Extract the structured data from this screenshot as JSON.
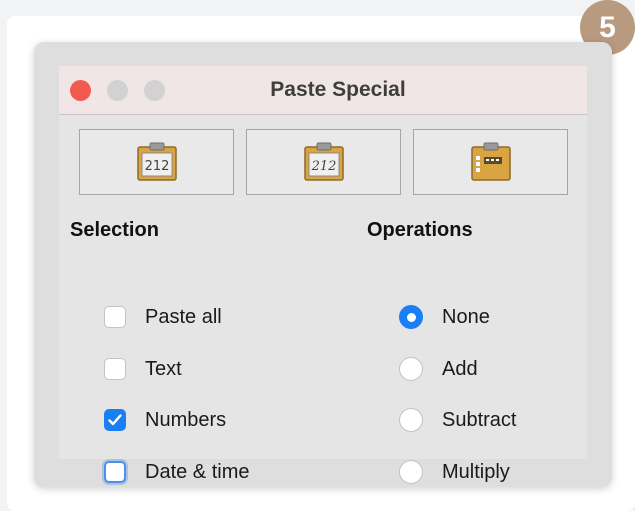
{
  "step_badge": "5",
  "window": {
    "title": "Paste Special"
  },
  "presets": [
    {
      "icon": "clipboard-numbers-icon",
      "text": "212"
    },
    {
      "icon": "clipboard-formatted-numbers-icon",
      "text": "212"
    },
    {
      "icon": "clipboard-formats-icon"
    }
  ],
  "selection": {
    "title": "Selection",
    "options": [
      {
        "label": "Paste all",
        "checked": false
      },
      {
        "label": "Text",
        "checked": false
      },
      {
        "label": "Numbers",
        "checked": true
      },
      {
        "label": "Date & time",
        "checked": false,
        "focused": true
      }
    ]
  },
  "operations": {
    "title": "Operations",
    "options": [
      {
        "label": "None",
        "selected": true
      },
      {
        "label": "Add",
        "selected": false
      },
      {
        "label": "Subtract",
        "selected": false
      },
      {
        "label": "Multiply",
        "selected": false
      }
    ]
  },
  "colors": {
    "accent": "#1a7ef4",
    "close": "#f25a4f",
    "badge": "#b89a80"
  }
}
